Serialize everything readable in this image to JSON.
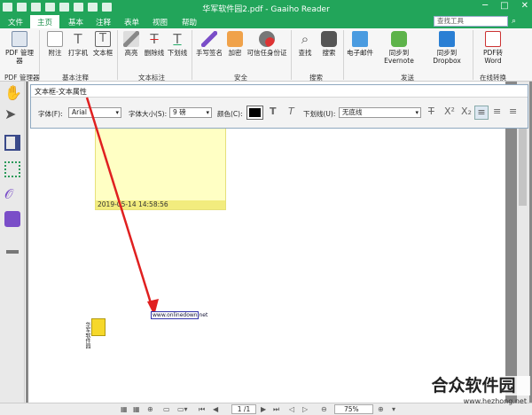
{
  "app": {
    "title": "华军软件园2.pdf - Gaaiho Reader"
  },
  "menu": {
    "items": [
      "文件",
      "主页",
      "基本",
      "注释",
      "表单",
      "视图",
      "帮助"
    ],
    "active": "主页",
    "search_placeholder": "查找工具"
  },
  "ribbon": {
    "buttons": [
      "PDF 管理器",
      "附注",
      "打字机",
      "文本框",
      "高亮",
      "删除线",
      "下划线",
      "手写签名",
      "加密",
      "可信任身份证",
      "查找",
      "搜索",
      "电子邮件",
      "同步到Evernote",
      "同步到Dropbox",
      "PDF转Word"
    ],
    "groups": [
      "PDF 管理器",
      "基本注释",
      "文本标注",
      "安全",
      "搜索",
      "发送",
      "在线转换"
    ]
  },
  "text_props": {
    "title": "文本框-文本属性",
    "font_label": "字体(F):",
    "font_value": "Arial",
    "size_label": "字体大小(S):",
    "size_value": "9 磅",
    "color_label": "颜色(C):",
    "underline_label": "下划线(U):",
    "underline_value": "无底线"
  },
  "sticky": {
    "timestamp": "2019-05-14 14:58:56"
  },
  "doc": {
    "link_text": "www.onlinedown.net",
    "attachment_label": "华军软件园"
  },
  "status": {
    "page": "1 /1",
    "zoom": "75%"
  },
  "watermark": {
    "text": "合众软件园",
    "url": "www.hezhong.net"
  },
  "colors": {
    "accent": "#22a55a",
    "sticky": "#ffffc4",
    "arrow": "#e02020"
  }
}
